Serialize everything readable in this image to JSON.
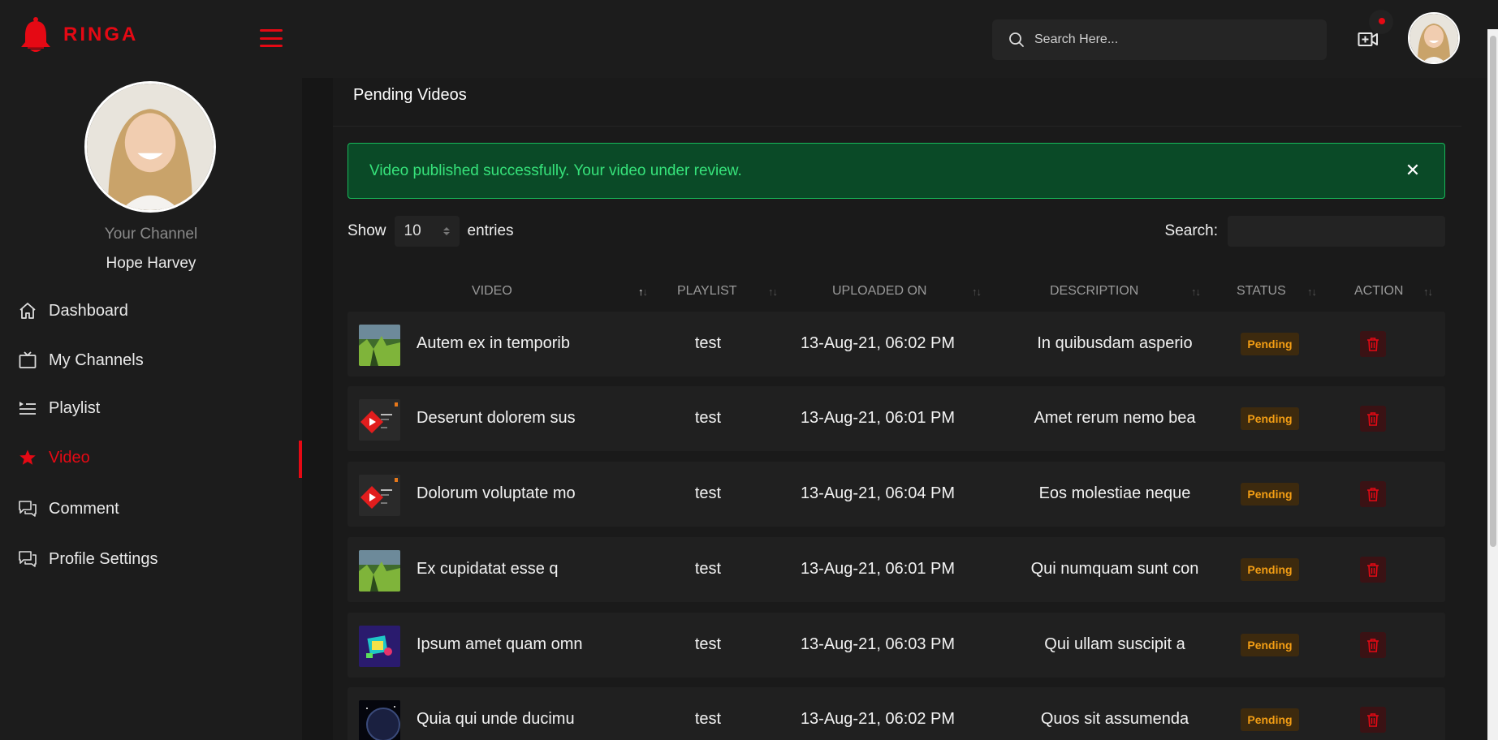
{
  "app": {
    "brand": "RINGA",
    "brand_color": "#e50914"
  },
  "header": {
    "search_placeholder": "Search Here...",
    "upload_icon": "video-add-icon",
    "notification_indicator": true
  },
  "sidebar": {
    "channel_label": "Your Channel",
    "channel_name": "Hope Harvey",
    "items": [
      {
        "label": "Dashboard",
        "icon": "home-icon",
        "active": false
      },
      {
        "label": "My Channels",
        "icon": "tv-icon",
        "active": false
      },
      {
        "label": "Playlist",
        "icon": "playlist-icon",
        "active": false
      },
      {
        "label": "Video",
        "icon": "star-icon",
        "active": true
      },
      {
        "label": "Comment",
        "icon": "comment-icon",
        "active": false
      },
      {
        "label": "Profile Settings",
        "icon": "comment-icon",
        "active": false
      }
    ]
  },
  "main": {
    "title": "Pending Videos",
    "alert": {
      "text": "Video published successfully. Your video under review.",
      "close_glyph": "✕"
    },
    "table_controls": {
      "show_label": "Show",
      "entries_value": "10",
      "entries_label": "entries",
      "search_label": "Search:"
    },
    "columns": [
      "VIDEO",
      "PLAYLIST",
      "UPLOADED ON",
      "DESCRIPTION",
      "STATUS",
      "ACTION"
    ],
    "rows": [
      {
        "thumb": "forest",
        "title": "Autem ex in temporib",
        "playlist": "test",
        "uploaded": "13-Aug-21, 06:02 PM",
        "description": "In quibusdam asperio",
        "status": "Pending"
      },
      {
        "thumb": "youtube",
        "title": "Deserunt dolorem sus",
        "playlist": "test",
        "uploaded": "13-Aug-21, 06:01 PM",
        "description": "Amet rerum nemo bea",
        "status": "Pending"
      },
      {
        "thumb": "youtube",
        "title": "Dolorum voluptate mo",
        "playlist": "test",
        "uploaded": "13-Aug-21, 06:04 PM",
        "description": "Eos molestiae neque",
        "status": "Pending"
      },
      {
        "thumb": "forest",
        "title": "Ex cupidatat esse q",
        "playlist": "test",
        "uploaded": "13-Aug-21, 06:01 PM",
        "description": "Qui numquam sunt con",
        "status": "Pending"
      },
      {
        "thumb": "art",
        "title": "Ipsum amet quam omn",
        "playlist": "test",
        "uploaded": "13-Aug-21, 06:03 PM",
        "description": "Qui ullam suscipit a",
        "status": "Pending"
      },
      {
        "thumb": "space",
        "title": "Quia qui unde ducimu",
        "playlist": "test",
        "uploaded": "13-Aug-21, 06:02 PM",
        "description": "Quos sit assumenda",
        "status": "Pending"
      }
    ]
  },
  "colors": {
    "accent": "#e50914",
    "success_bg": "#0a4a27",
    "success_text": "#36e27a",
    "pending_text": "#f29d14"
  }
}
